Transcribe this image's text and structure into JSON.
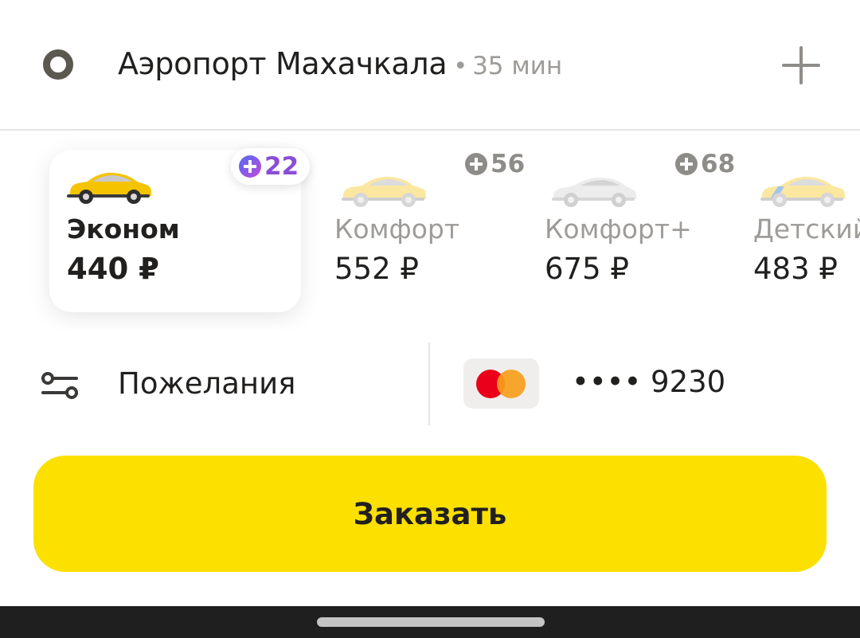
{
  "route": {
    "destination": "Аэропорт Махачкала",
    "separator": "•",
    "eta": "35 мин",
    "icons": {
      "point": "destination-ring-icon",
      "add": "plus-icon"
    }
  },
  "tariffs": [
    {
      "id": "econom",
      "name": "Эконом",
      "price": "440 ₽",
      "plus_points": "22",
      "selected": true,
      "car_color": "#f5c400"
    },
    {
      "id": "comfort",
      "name": "Комфорт",
      "price": "552 ₽",
      "plus_points": "56",
      "selected": false,
      "car_color": "#fbe7a0"
    },
    {
      "id": "comfort_plus",
      "name": "Комфорт+",
      "price": "675 ₽",
      "plus_points": "68",
      "selected": false,
      "car_color": "#ececec"
    },
    {
      "id": "kids",
      "name": "Детский",
      "price": "483 ₽",
      "plus_points": "",
      "selected": false,
      "car_color": "#fbe7a0"
    }
  ],
  "options": {
    "wishes_label": "Пожелания",
    "wishes_icon": "sliders-icon",
    "payment": {
      "card_brand_icon": "mastercard-icon",
      "card_number": "•••• 9230"
    }
  },
  "order": {
    "label": "Заказать",
    "color": "#fce000"
  },
  "colors": {
    "accent": "#fce000",
    "muted_text": "#9e9b98",
    "plus_gradient_start": "#4f6df5",
    "plus_gradient_end": "#c24ad6"
  }
}
